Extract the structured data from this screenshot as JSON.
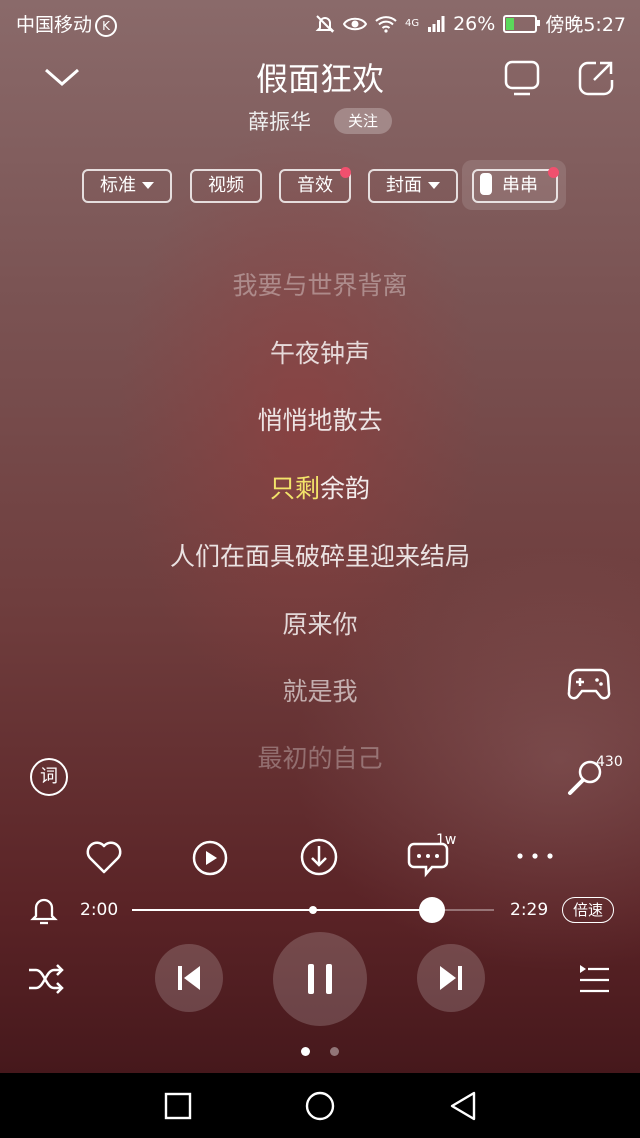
{
  "status": {
    "carrier": "中国移动",
    "carrier_badge": "K",
    "network": "4G",
    "battery": "26%",
    "time": "傍晚5:27"
  },
  "header": {
    "title": "假面狂欢",
    "artist": "薛振华",
    "follow_label": "关注"
  },
  "chips": [
    {
      "label": "标准",
      "dropdown": true
    },
    {
      "label": "视频",
      "dropdown": false
    },
    {
      "label": "音效",
      "dropdown": false
    },
    {
      "label": "封面",
      "dropdown": true
    },
    {
      "label": "串串",
      "dropdown": false
    }
  ],
  "lyrics": [
    {
      "text": "我要与世界背离"
    },
    {
      "text": "午夜钟声"
    },
    {
      "text": "悄悄地散去"
    },
    {
      "text_sung": "只剩",
      "text_rest": "余韵"
    },
    {
      "text": "人们在面具破碎里迎来结局"
    },
    {
      "text": "原来你"
    },
    {
      "text": "就是我"
    },
    {
      "text": "最初的自己"
    }
  ],
  "side": {
    "lyrics_icon_char": "词",
    "mic_count": "430"
  },
  "actions": {
    "comment_count": "1w"
  },
  "player": {
    "current_time": "2:00",
    "total_time": "2:29",
    "speed_label": "倍速",
    "progress": 0.828,
    "buffer": 0.5
  },
  "icons": [
    "chevron-down-icon",
    "tv-icon",
    "share-icon",
    "gamepad-icon",
    "mic-icon",
    "heart-icon",
    "play-video-icon",
    "download-icon",
    "comment-icon",
    "more-icon",
    "bell-icon",
    "shuffle-icon",
    "previous-icon",
    "pause-icon",
    "next-icon",
    "playlist-icon"
  ],
  "colors": {
    "accent_lyric": "#f3e36a",
    "badge_dot": "#f0506e"
  }
}
